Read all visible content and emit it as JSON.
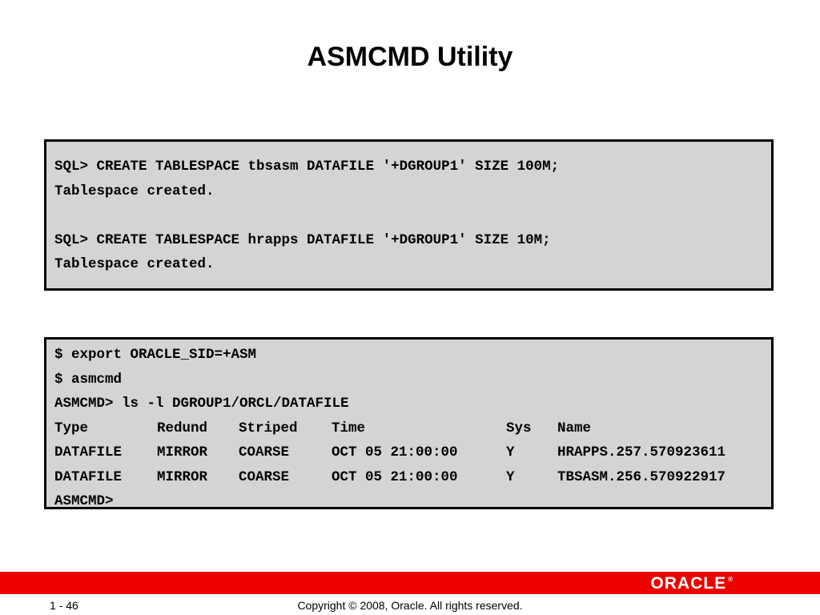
{
  "slide": {
    "title": "ASMCMD Utility"
  },
  "sql_block": {
    "lines": [
      "SQL> CREATE TABLESPACE tbsasm DATAFILE '+DGROUP1' SIZE 100M;",
      "Tablespace created.",
      "",
      "SQL> CREATE TABLESPACE hrapps DATAFILE '+DGROUP1' SIZE 10M;",
      "Tablespace created."
    ]
  },
  "shell_block": {
    "lines": [
      "$ export ORACLE_SID=+ASM",
      "$ asmcmd",
      "ASMCMD> ls -l DGROUP1/ORCL/DATAFILE"
    ],
    "columns": [
      "Type",
      "Redund",
      "Striped",
      "Time",
      "Sys",
      "Name"
    ],
    "rows": [
      [
        "DATAFILE",
        "MIRROR",
        "COARSE",
        "OCT 05 21:00:00",
        "Y",
        "HRAPPS.257.570923611"
      ],
      [
        "DATAFILE",
        "MIRROR",
        "COARSE",
        "OCT 05 21:00:00",
        "Y",
        "TBSASM.256.570922917"
      ]
    ],
    "prompt": "ASMCMD>"
  },
  "footer": {
    "page_number": "1 - 46",
    "copyright": "Copyright © 2008, Oracle. All rights reserved.",
    "logo_text": "ORACLE",
    "logo_mark": "®",
    "brand_color": "#ee0000"
  }
}
